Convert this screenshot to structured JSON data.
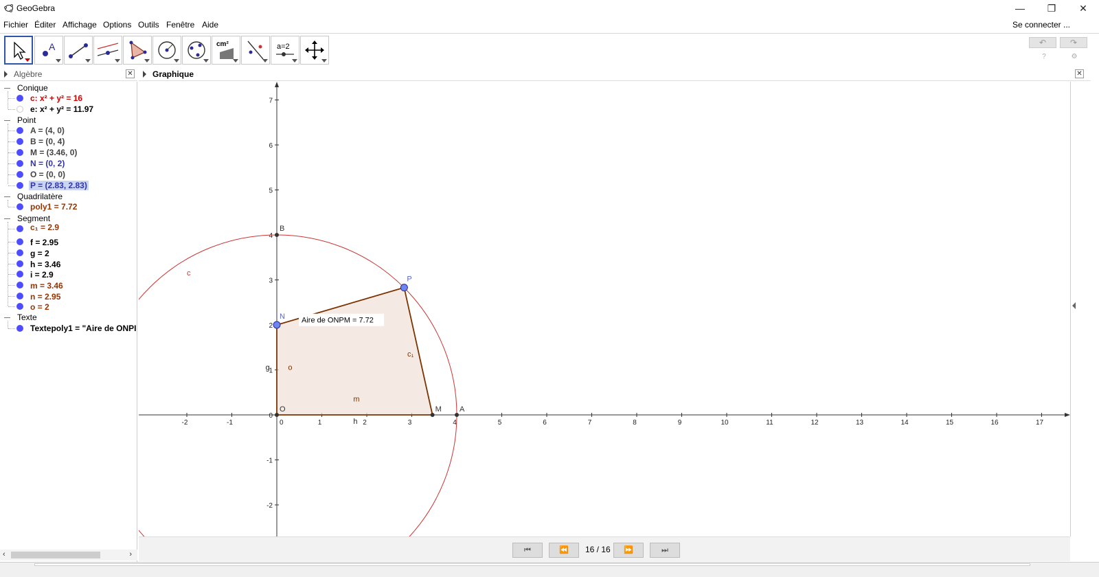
{
  "window": {
    "title": "GeoGebra",
    "minimize": "—",
    "restore": "❐",
    "close": "✕"
  },
  "menu": {
    "items": [
      "Fichier",
      "Éditer",
      "Affichage",
      "Options",
      "Outils",
      "Fenêtre",
      "Aide"
    ],
    "login": "Se connecter ..."
  },
  "toolbar": {
    "tools": [
      {
        "name": "move-tool",
        "active": true
      },
      {
        "name": "point-tool",
        "label": "A"
      },
      {
        "name": "segment-tool"
      },
      {
        "name": "parallel-tool"
      },
      {
        "name": "polygon-tool"
      },
      {
        "name": "circle-tool"
      },
      {
        "name": "conic-tool"
      },
      {
        "name": "area-tool",
        "label": "cm²"
      },
      {
        "name": "reflect-tool"
      },
      {
        "name": "slider-tool",
        "label": "a=2"
      },
      {
        "name": "move-view-tool"
      }
    ],
    "undo": "↶",
    "redo": "↷"
  },
  "algebra": {
    "title": "Algèbre",
    "categories": [
      {
        "name": "Conique",
        "items": [
          {
            "text": "c: x² + y² = 16",
            "color": "#cc0000",
            "shown": true
          },
          {
            "text": "e: x² + y² = 11.97",
            "color": "#000000",
            "shown": false
          }
        ]
      },
      {
        "name": "Point",
        "items": [
          {
            "text": "A = (4, 0)",
            "color": "#444444",
            "shown": true
          },
          {
            "text": "B = (0, 4)",
            "color": "#444444",
            "shown": true
          },
          {
            "text": "M = (3.46, 0)",
            "color": "#444444",
            "shown": true
          },
          {
            "text": "N = (0, 2)",
            "color": "#3333aa",
            "shown": true
          },
          {
            "text": "O = (0, 0)",
            "color": "#444444",
            "shown": true
          },
          {
            "text": "P = (2.83, 2.83)",
            "color": "#3333aa",
            "shown": true,
            "selected": true
          }
        ]
      },
      {
        "name": "Quadrilatère",
        "items": [
          {
            "text": "poly1 = 7.72",
            "color": "#993300",
            "shown": true
          }
        ]
      },
      {
        "name": "Segment",
        "items": [
          {
            "text": "c₁ = 2.9",
            "color": "#993300",
            "shown": true
          },
          {
            "text": "f = 2.95",
            "color": "#000000",
            "shown": true
          },
          {
            "text": "g = 2",
            "color": "#000000",
            "shown": true
          },
          {
            "text": "h = 3.46",
            "color": "#000000",
            "shown": true
          },
          {
            "text": "i = 2.9",
            "color": "#000000",
            "shown": true
          },
          {
            "text": "m = 3.46",
            "color": "#993300",
            "shown": true
          },
          {
            "text": "n = 2.95",
            "color": "#993300",
            "shown": true
          },
          {
            "text": "o = 2",
            "color": "#993300",
            "shown": true
          }
        ]
      },
      {
        "name": "Texte",
        "items": [
          {
            "text": "Textepoly1 = \"Aire de  ONPI",
            "color": "#000000",
            "shown": true
          }
        ]
      }
    ]
  },
  "graphics": {
    "title": "Graphique",
    "x_ticks": [
      "-2",
      "-1",
      "0",
      "1",
      "2",
      "3",
      "4",
      "5",
      "6",
      "7",
      "8",
      "9",
      "10",
      "11",
      "12",
      "13",
      "14",
      "15",
      "16",
      "17"
    ],
    "y_ticks": [
      "-2",
      "-1",
      "0",
      "1",
      "2",
      "3",
      "4",
      "5",
      "6",
      "7"
    ],
    "points": [
      {
        "label": "O",
        "x": 0,
        "y": 0
      },
      {
        "label": "A",
        "x": 4,
        "y": 0
      },
      {
        "label": "B",
        "x": 0,
        "y": 4
      },
      {
        "label": "M",
        "x": 3.46,
        "y": 0
      },
      {
        "label": "N",
        "x": 0,
        "y": 2
      },
      {
        "label": "P",
        "x": 2.83,
        "y": 2.83
      }
    ],
    "circle": {
      "label": "c",
      "r": 4,
      "color": "#cc3333"
    },
    "polygon_fill": "#f2e2da",
    "polygon_stroke": "#7a3300",
    "segment_labels": [
      "o",
      "m",
      "h",
      "g",
      "c₁"
    ],
    "area_text": "Aire de  ONPM = 7.72"
  },
  "navigation": {
    "first": "⏮",
    "prev": "⏪",
    "step": "16 / 16",
    "next": "⏩",
    "last": "⏭"
  }
}
